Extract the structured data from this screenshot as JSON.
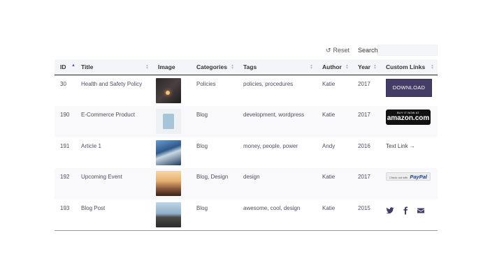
{
  "toolbar": {
    "reset_label": "Reset",
    "search_label": "Search:",
    "search_value": ""
  },
  "columns": [
    {
      "label": "ID",
      "sorted": "asc"
    },
    {
      "label": "Title"
    },
    {
      "label": "Image"
    },
    {
      "label": "Categories"
    },
    {
      "label": "Tags"
    },
    {
      "label": "Author"
    },
    {
      "label": "Year"
    },
    {
      "label": "Custom Links"
    }
  ],
  "rows": [
    {
      "id": "30",
      "title": "Health and Safety Policy",
      "image": "candle-photo",
      "categories": "Policies",
      "tags": "policies, procedures",
      "author": "Katie",
      "year": "2017",
      "link_type": "download-button",
      "link_label": "DOWNLOAD"
    },
    {
      "id": "190",
      "title": "E-Commerce Product",
      "image": "tshirt-photo",
      "categories": "Blog",
      "tags": "development, wordpress",
      "author": "Katie",
      "year": "2017",
      "link_type": "amazon-button",
      "link_top": "BUY IT NOW AT",
      "link_label": "amazon.com"
    },
    {
      "id": "191",
      "title": "Article 1",
      "image": "aerial-photo",
      "categories": "Blog",
      "tags": "money, people, power",
      "author": "Andy",
      "year": "2016",
      "link_type": "text-link",
      "link_label": "Text Link →"
    },
    {
      "id": "192",
      "title": "Upcoming Event",
      "image": "sunset-people-photo",
      "categories": "Blog, Design",
      "tags": "design",
      "author": "Katie",
      "year": "2017",
      "link_type": "paypal-button",
      "link_top": "Check out with",
      "link_label": "PayPal"
    },
    {
      "id": "193",
      "title": "Blog Post",
      "image": "pier-photo",
      "categories": "Blog",
      "tags": "awesome, cool, design",
      "author": "Katie",
      "year": "2015",
      "link_type": "social-icons",
      "icons": [
        "twitter-icon",
        "facebook-icon",
        "email-icon"
      ]
    }
  ],
  "colors": {
    "accent": "#453d66",
    "social_icon": "#453d66",
    "header_bg": "#f4f5f8"
  }
}
